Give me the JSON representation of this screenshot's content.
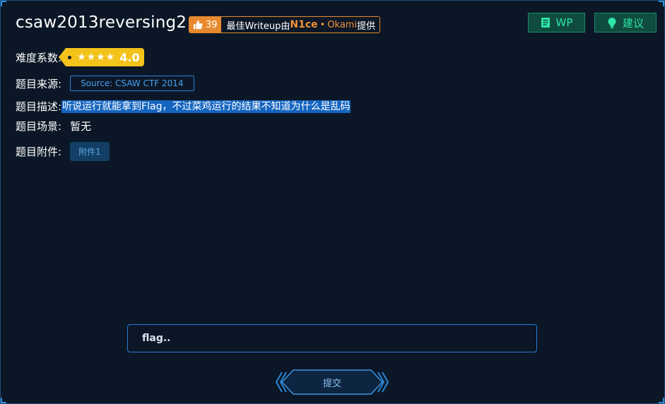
{
  "challenge": {
    "title": "csaw2013reversing2",
    "like_count": "39",
    "writeup_prefix": "最佳Writeup由",
    "writeup_author": "N1ce",
    "writeup_separator": "•",
    "writeup_author2": "Okami",
    "writeup_suffix": "提供"
  },
  "buttons": {
    "wp": "WP",
    "suggest": "建议"
  },
  "fields": {
    "difficulty_label": "难度系数:",
    "difficulty_stars": "★★★★",
    "difficulty_value": "4.0",
    "source_label": "题目来源:",
    "source_value": "Source: CSAW CTF 2014",
    "description_label": "题目描述:",
    "description_value": "听说运行就能拿到Flag，不过菜鸡运行的结果不知道为什么是乱码",
    "scene_label": "题目场景:",
    "scene_value": "暂无",
    "attachment_label": "题目附件:",
    "attachment_value": "附件1"
  },
  "flag": {
    "placeholder": "flag.."
  },
  "submit": {
    "label": "提交"
  },
  "colors": {
    "background": "#0b1726",
    "accent_green": "#2ee6a8",
    "accent_orange": "#e78a2f",
    "accent_blue": "#2f80d6",
    "difficulty_yellow": "#f3c21b",
    "highlight_blue": "#1565c0"
  }
}
